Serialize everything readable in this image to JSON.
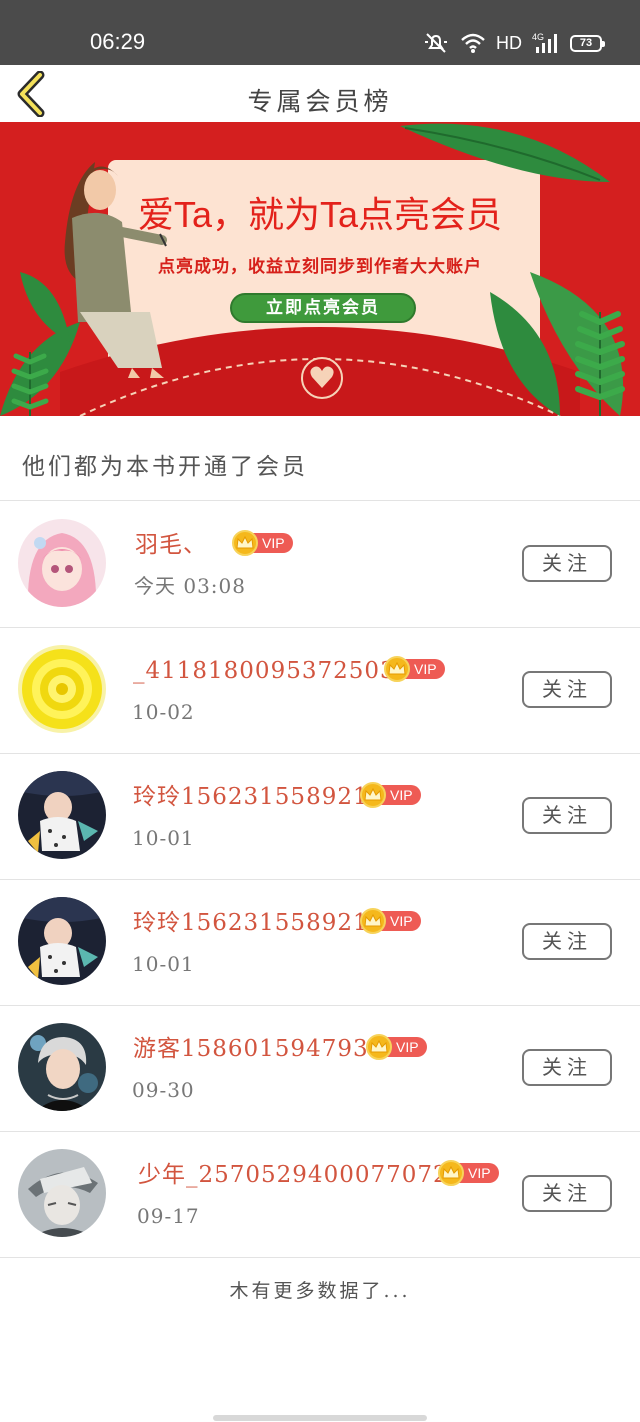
{
  "status_bar": {
    "time": "06:29",
    "network": "HD",
    "cell_type": "4G",
    "battery": "73",
    "icons": [
      "mute-bell-icon",
      "wifi-icon",
      "signal-icon",
      "battery-icon"
    ]
  },
  "nav": {
    "title": "专属会员榜",
    "back_icon": "chevron-left-icon"
  },
  "banner": {
    "headline": "爱Ta，就为Ta点亮会员",
    "subtitle": "点亮成功，收益立刻同步到作者大大账户",
    "button_label": "立即点亮会员",
    "colors": {
      "background": "#d41f1f",
      "card": "#fde3d2",
      "button": "#3f9a3c",
      "leaf": "#2e8b3e"
    }
  },
  "section": {
    "title": "他们都为本书开通了会员"
  },
  "members": [
    {
      "name": "羽毛、",
      "date": "今天  03:08",
      "vip": "VIP",
      "follow": "关注",
      "avatar": "anime-girl-avatar"
    },
    {
      "name": "_4118180095372503O",
      "date": "10-02",
      "vip": "VIP",
      "follow": "关注",
      "avatar": "yellow-mandala-avatar"
    },
    {
      "name": "玲玲1562315589211",
      "date": "10-01",
      "vip": "VIP",
      "follow": "关注",
      "avatar": "baby-photo-avatar"
    },
    {
      "name": "玲玲1562315589211",
      "date": "10-01",
      "vip": "VIP",
      "follow": "关注",
      "avatar": "baby-photo-avatar"
    },
    {
      "name": "游客1586015947931",
      "date": "09-30",
      "vip": "VIP",
      "follow": "关注",
      "avatar": "young-man-avatar"
    },
    {
      "name": "少年_25705294000770722",
      "date": "09-17",
      "vip": "VIP",
      "follow": "关注",
      "avatar": "anime-boy-avatar"
    }
  ],
  "footer": {
    "text": "木有更多数据了..."
  },
  "colors": {
    "accent": "#d2553f",
    "vip_tag": "#ee5b54",
    "vip_crown": "#f5b81c",
    "status_bar": "#4b4b4b"
  }
}
